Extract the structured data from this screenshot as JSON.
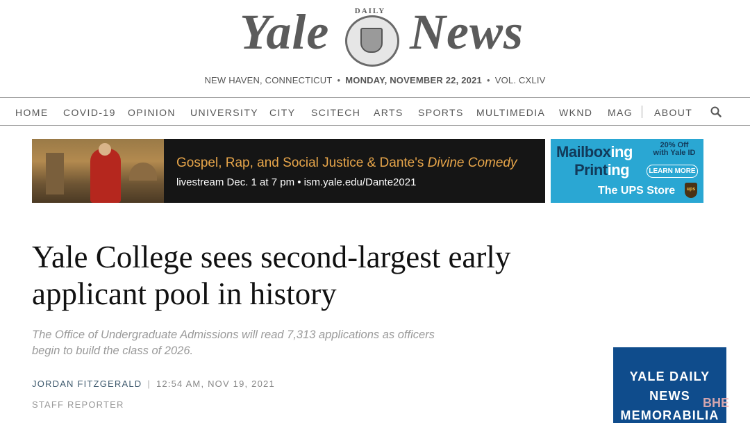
{
  "masthead": {
    "logo_left": "Yale",
    "logo_right": "News",
    "seal_text": "DAILY",
    "location": "NEW HAVEN, CONNECTICUT",
    "date": "MONDAY, NOVEMBER 22, 2021",
    "volume": "VOL. CXLIV",
    "separator": "•"
  },
  "nav": {
    "items": [
      "HOME",
      "COVID-19",
      "OPINION",
      "UNIVERSITY",
      "CITY",
      "SCITECH",
      "ARTS",
      "SPORTS",
      "MULTIMEDIA",
      "WKND",
      "MAG",
      "ABOUT"
    ],
    "search_icon": "search-icon"
  },
  "ads": {
    "main": {
      "title_prefix": "Gospel, Rap, and Social Justice & Dante's ",
      "title_italic": "Divine Comedy",
      "subtitle": "livestream Dec. 1 at 7 pm • ism.yale.edu/Dante2021"
    },
    "ups": {
      "mailbox_a": "Mailbox",
      "mailbox_b": "ing",
      "printing_a": "Print",
      "printing_b": "ing",
      "offer_line1": "20% Off",
      "offer_line2": "with Yale ID",
      "learn_more": "LEARN MORE",
      "store": "The UPS Store",
      "shield": "ups"
    },
    "memorabilia": {
      "line1": "YALE DAILY",
      "line2": "NEWS",
      "line3": "MEMORABILIA"
    }
  },
  "article": {
    "headline": "Yale College sees second-largest early applicant pool in history",
    "dek": "The Office of Undergraduate Admissions will read 7,313 applications as officers begin to build the class of 2026.",
    "author": "JORDAN FITZGERALD",
    "divider": "|",
    "timestamp": "12:54 AM, NOV 19, 2021",
    "role": "STAFF REPORTER"
  },
  "watermark": "BHE"
}
